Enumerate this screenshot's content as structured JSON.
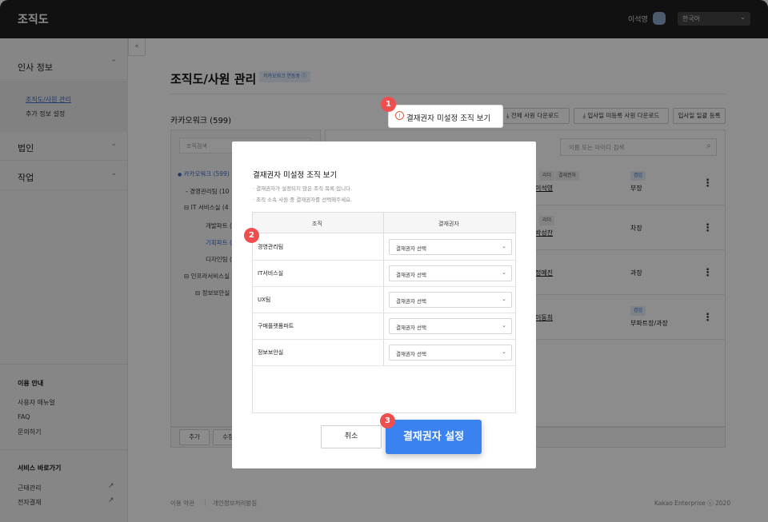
{
  "topbar": {
    "title": "조직도",
    "user_name": "이석영",
    "language": "한국어"
  },
  "sidebar": {
    "collapse_glyph": "«",
    "menu": [
      {
        "label": "인사 정보",
        "chevron": "up"
      },
      {
        "label": "법인",
        "chevron": "down"
      },
      {
        "label": "작업",
        "chevron": "down"
      }
    ],
    "submenu": [
      "조직도/사원 관리",
      "추가 정보 설정"
    ],
    "guide_title": "이용 안내",
    "guide_links": [
      "사용자 매뉴얼",
      "FAQ",
      "문의하기"
    ],
    "shortcut_title": "서비스 바로가기",
    "shortcut_links": [
      "근태관리",
      "전자결재"
    ]
  },
  "page": {
    "title": "조직도/사원 관리",
    "sync_badge": "카카오워크 연동중 ⓘ",
    "org_name": "카카오워크 (599)"
  },
  "toolbar": {
    "all_download": "전체 사원 다운로드",
    "pending_download": "입사일 미등록 사원 다운로드",
    "bulk_register": "입사일 일괄 등록"
  },
  "tree": {
    "search_placeholder": "조직검색",
    "items": [
      "카카오워크 (599)",
      "경영관리팀 (10",
      "IT 서비스실 (4",
      "개발파트 (",
      "기획파트 (",
      "디자인팀 (",
      "인프라서비스실",
      "정보보안실"
    ]
  },
  "employee_search": {
    "placeholder": "이름 또는 아이디 검색"
  },
  "employees": [
    {
      "name": "이석영",
      "tags": [
        "리더",
        "결재권자"
      ],
      "badge": "겸임",
      "position": "부장"
    },
    {
      "name": "박성찬",
      "tags": [
        "리더"
      ],
      "badge": "",
      "position": "차장"
    },
    {
      "name": "정예진",
      "tags": [],
      "badge": "",
      "position": "과장"
    },
    {
      "name": "이동희",
      "tags": [],
      "badge": "겸임",
      "position": "부파트장/과장"
    }
  ],
  "tree_buttons": {
    "add": "추가",
    "edit": "수정"
  },
  "footer": {
    "terms": "이용 약관",
    "privacy": "개인정보처리방침",
    "copyright": "Kakao Enterprise  ⓒ 2020"
  },
  "highlight": {
    "warn_glyph": "!",
    "label": "결재권자 미설정 조직 보기"
  },
  "steps": [
    "1",
    "2",
    "3"
  ],
  "modal": {
    "title": "결재권자 미설정 조직 보기",
    "desc1": "· 결재권자가 설정되지 않은 조직 목록 입니다.",
    "desc2": "· 조직 소속 사원 중 결재권자를 선택해주세요.",
    "col_org": "조직",
    "col_approver": "결재권자",
    "rows": [
      {
        "org": "경영관리팀",
        "select": "결재권자 선택"
      },
      {
        "org": "IT서비스실",
        "select": "결재권자 선택"
      },
      {
        "org": "UX팀",
        "select": "결재권자 선택"
      },
      {
        "org": "구매플랫폼파트",
        "select": "결재권자 선택"
      },
      {
        "org": "정보보안실",
        "select": "결재권자 선택"
      }
    ],
    "cancel": "취소",
    "confirm": "결재권자 설정"
  },
  "colors": {
    "accent": "#3a82f0",
    "step_badge": "#ef4e4e",
    "topbar": "#1f1f21"
  }
}
